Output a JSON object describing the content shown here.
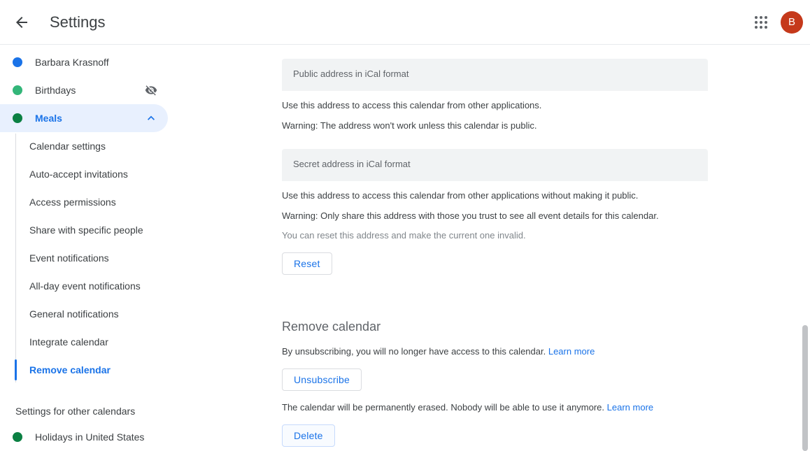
{
  "header": {
    "back_icon": "arrow-back-icon",
    "title": "Settings",
    "apps_icon": "apps-grid-icon",
    "avatar_letter": "B"
  },
  "sidebar": {
    "calendars": [
      {
        "label": "Barbara Krasnoff",
        "color": "#1a73e8",
        "active": false,
        "has_visibility_off": false,
        "has_chevron": false
      },
      {
        "label": "Birthdays",
        "color": "#33b679",
        "active": false,
        "has_visibility_off": true,
        "has_chevron": false
      },
      {
        "label": "Meals",
        "color": "#0b8043",
        "active": true,
        "has_visibility_off": false,
        "has_chevron": true
      }
    ],
    "sub_items": [
      {
        "label": "Calendar settings",
        "active": false
      },
      {
        "label": "Auto-accept invitations",
        "active": false
      },
      {
        "label": "Access permissions",
        "active": false
      },
      {
        "label": "Share with specific people",
        "active": false
      },
      {
        "label": "Event notifications",
        "active": false
      },
      {
        "label": "All-day event notifications",
        "active": false
      },
      {
        "label": "General notifications",
        "active": false
      },
      {
        "label": "Integrate calendar",
        "active": false
      },
      {
        "label": "Remove calendar",
        "active": true
      }
    ],
    "other_calendars_header": "Settings for other calendars",
    "other_calendars": [
      {
        "label": "Holidays in United States",
        "color": "#0b8043"
      }
    ]
  },
  "main": {
    "public_address": {
      "label": "Public address in iCal format",
      "value": "",
      "help": "Use this address to access this calendar from other applications.",
      "warning": "Warning: The address won't work unless this calendar is public."
    },
    "secret_address": {
      "label": "Secret address in iCal format",
      "value": "",
      "help": "Use this address to access this calendar from other applications without making it public.",
      "warning": "Warning: Only share this address with those you trust to see all event details for this calendar.",
      "note": "You can reset this address and make the current one invalid.",
      "reset_label": "Reset"
    },
    "remove_calendar": {
      "title": "Remove calendar",
      "unsubscribe_text": "By unsubscribing, you will no longer have access to this calendar.",
      "unsubscribe_link": "Learn more",
      "unsubscribe_label": "Unsubscribe",
      "delete_text": "The calendar will be permanently erased. Nobody will be able to use it anymore.",
      "delete_link": "Learn more",
      "delete_label": "Delete"
    }
  },
  "colors": {
    "accent": "#1a73e8",
    "active_pill": "#e8f0fe",
    "field_bg": "#f1f3f4",
    "avatar_bg": "#c5391b"
  }
}
